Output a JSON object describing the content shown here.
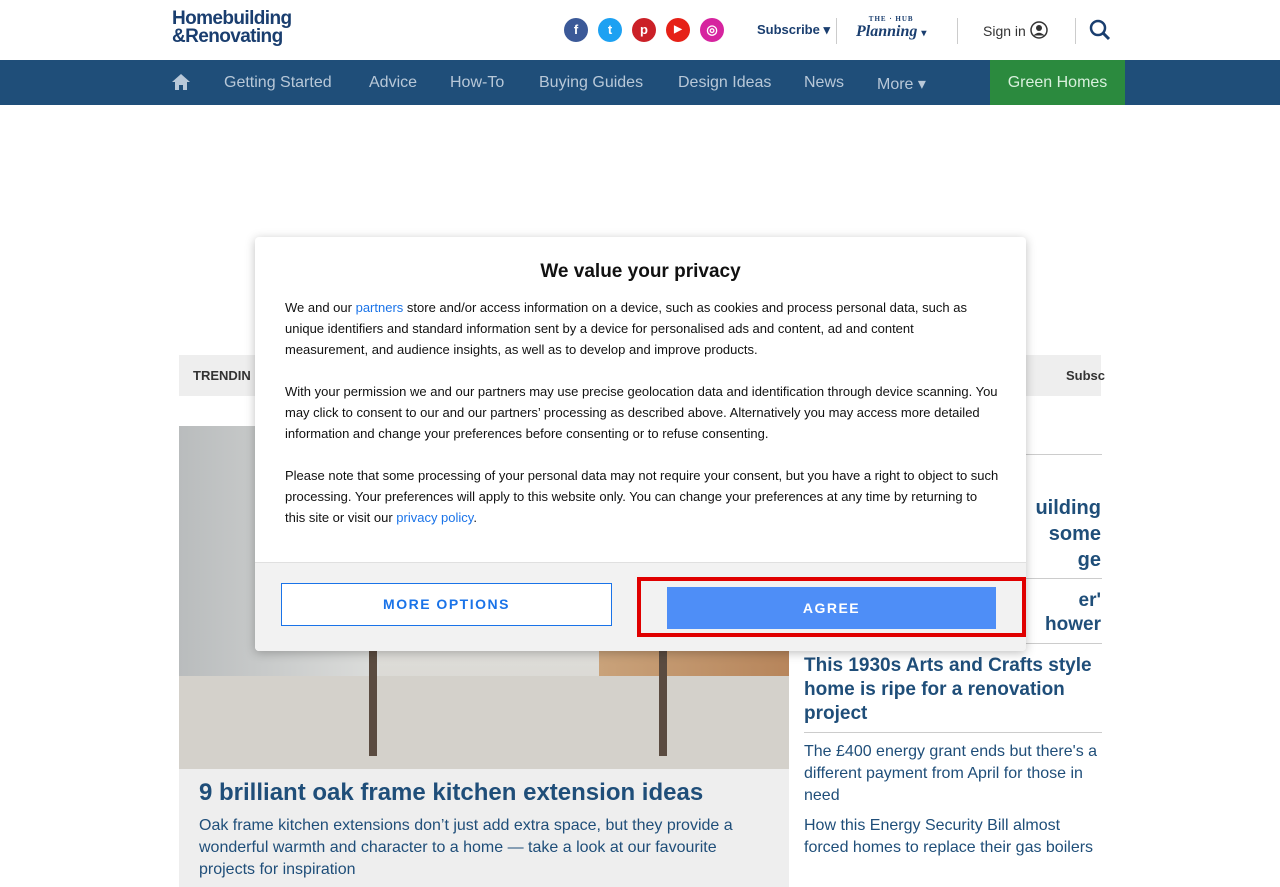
{
  "header": {
    "logo_line1": "Homebuilding",
    "logo_line2": "&Renovating",
    "subscribe_label": "Subscribe ▾",
    "planning_label": "Planning",
    "planning_sub": "THE · HUB",
    "signin_label": "Sign in",
    "social": [
      {
        "name": "facebook-icon",
        "glyph": "f",
        "color": "#3b5998"
      },
      {
        "name": "twitter-icon",
        "glyph": "t",
        "color": "#1da1f2"
      },
      {
        "name": "pinterest-icon",
        "glyph": "p",
        "color": "#cb2027"
      },
      {
        "name": "youtube-icon",
        "glyph": "▶",
        "color": "#e62117"
      },
      {
        "name": "instagram-icon",
        "glyph": "◎",
        "color": "#d6249f"
      }
    ]
  },
  "nav": {
    "items": [
      "Getting Started",
      "Advice",
      "How-To",
      "Buying Guides",
      "Design Ideas",
      "News",
      "More ▾"
    ],
    "green": "Green Homes"
  },
  "trending": {
    "label": "TRENDIN",
    "subscribe": "Subsc"
  },
  "hero": {
    "title": "9 brilliant oak frame kitchen extension ideas",
    "description": "Oak frame kitchen extensions don’t just add extra space, but they provide a wonderful warmth and character to a home — take a look at our favourite projects for inspiration"
  },
  "sidebar": {
    "head1_l1": "uilding",
    "head1_l2": "some",
    "head1_l3": "ge",
    "head2_l1": "er'",
    "head2_l2": "hower",
    "head3": "This 1930s Arts and Crafts style home is ripe for a renovation project",
    "link1": "The £400 energy grant ends but there's a different payment from April for those in need",
    "link2": "How this Energy Security Bill almost forced homes to replace their gas boilers"
  },
  "modal": {
    "title": "We value your privacy",
    "p1_a": "We and our ",
    "p1_link": "partners",
    "p1_b": " store and/or access information on a device, such as cookies and process personal data, such as unique identifiers and standard information sent by a device for personalised ads and content, ad and content measurement, and audience insights, as well as to develop and improve products.",
    "p2": "With your permission we and our partners may use precise geolocation data and identification through device scanning. You may click to consent to our and our partners’ processing as described above. Alternatively you may access more detailed information and change your preferences before consenting or to refuse consenting.",
    "p3_a": "Please note that some processing of your personal data may not require your consent, but you have a right to object to such processing. Your preferences will apply to this website only. You can change your preferences at any time by returning to this site or visit our ",
    "p3_link": "privacy policy",
    "p3_b": ".",
    "more_options": "MORE OPTIONS",
    "agree": "AGREE"
  }
}
